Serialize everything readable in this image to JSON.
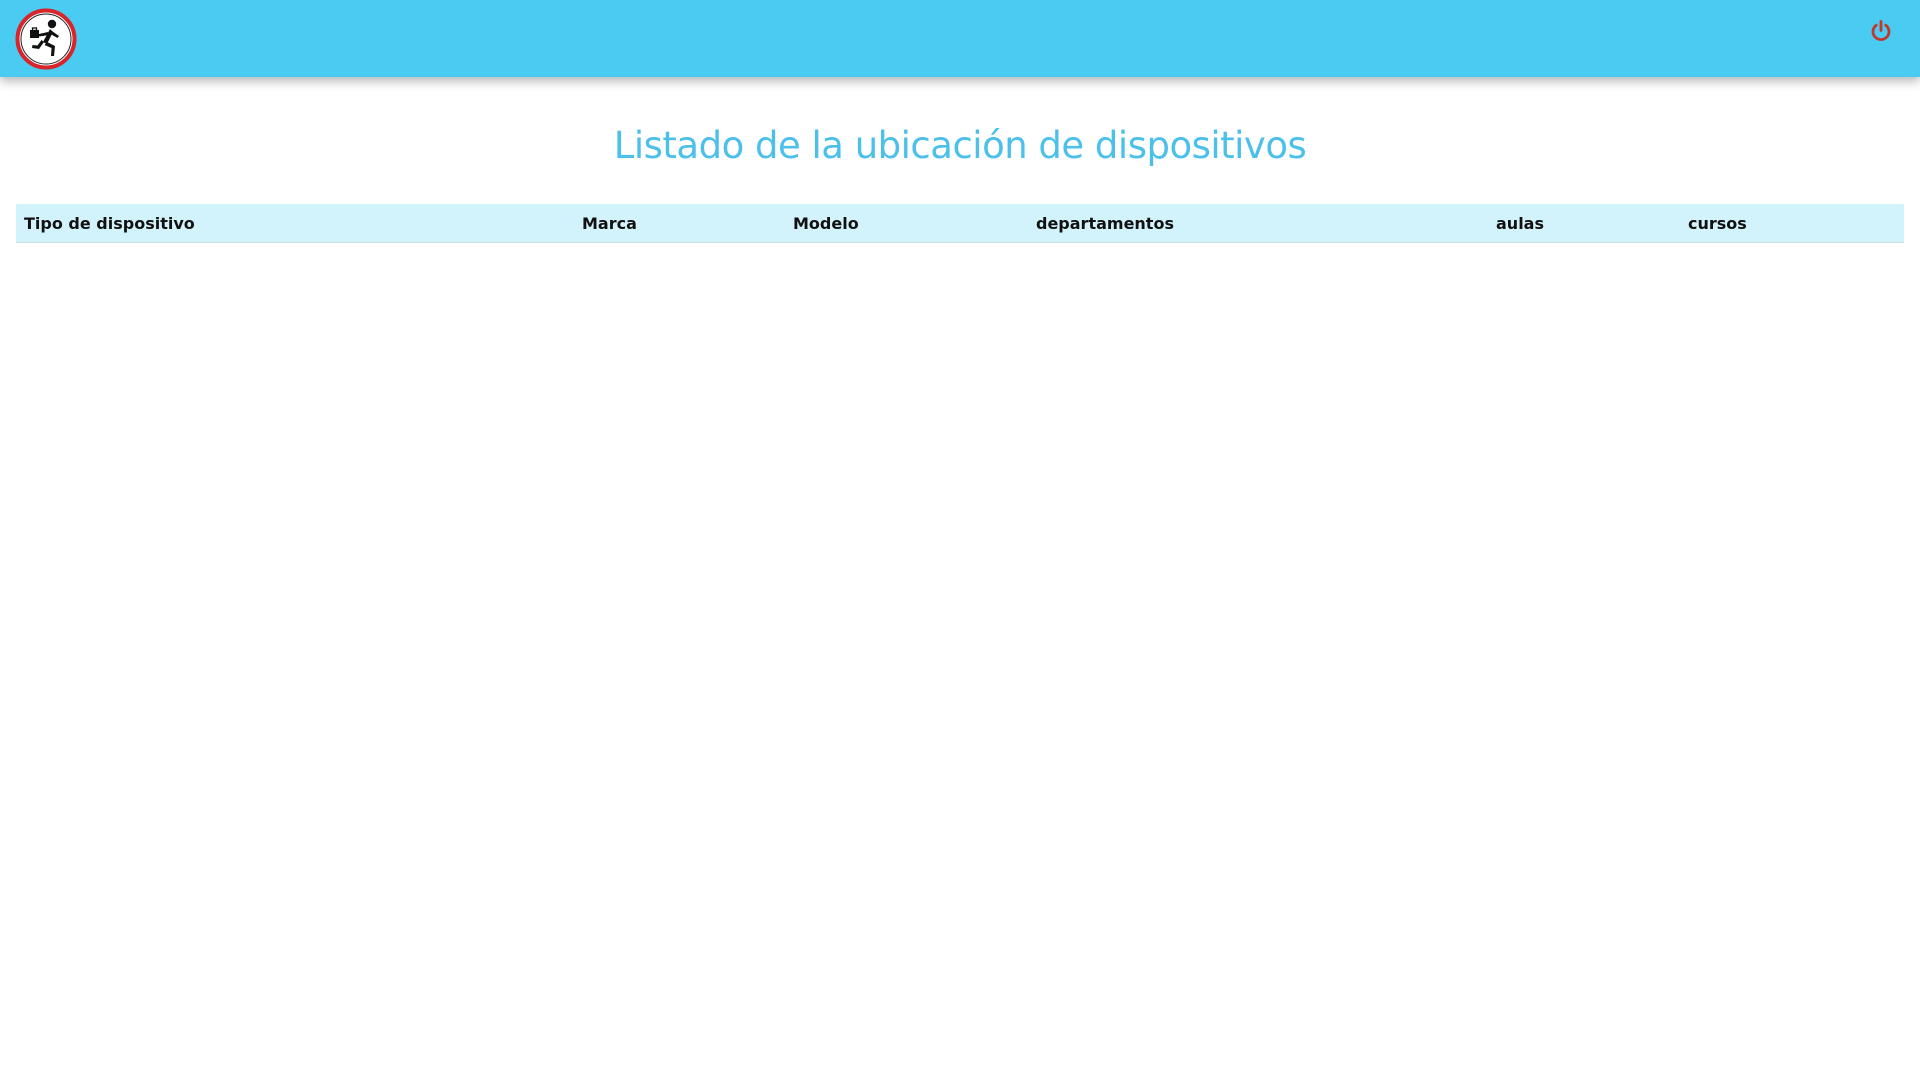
{
  "header": {
    "logo_icon": "running-person-logo-icon",
    "logout_icon": "power-icon",
    "bar_color": "#4acbf2",
    "logo_ring_color": "#d8242b",
    "power_icon_color": "#c0392b"
  },
  "page": {
    "title": "Listado de la ubicación de dispositivos",
    "title_color": "#4bc0ea"
  },
  "table": {
    "header_bg": "#d3f3fc",
    "columns": [
      "Tipo de dispositivo",
      "Marca",
      "Modelo",
      "departamentos",
      "aulas",
      "cursos"
    ],
    "rows": []
  }
}
